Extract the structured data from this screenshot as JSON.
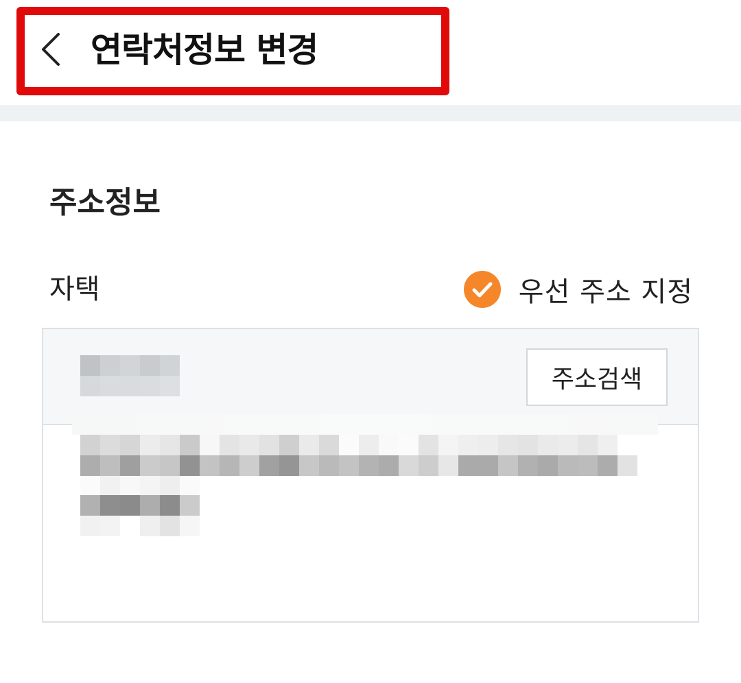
{
  "header": {
    "title": "연락처정보 변경",
    "back_icon": "chevron-left-icon",
    "highlight_color": "#e10a0a"
  },
  "address_section": {
    "title": "주소정보",
    "label": "자택",
    "priority": {
      "label": "우선 주소 지정",
      "checked": true,
      "icon": "check-circle-icon",
      "color": "#f5862a"
    },
    "search_button_label": "주소검색",
    "zip_code": "",
    "address": ""
  }
}
